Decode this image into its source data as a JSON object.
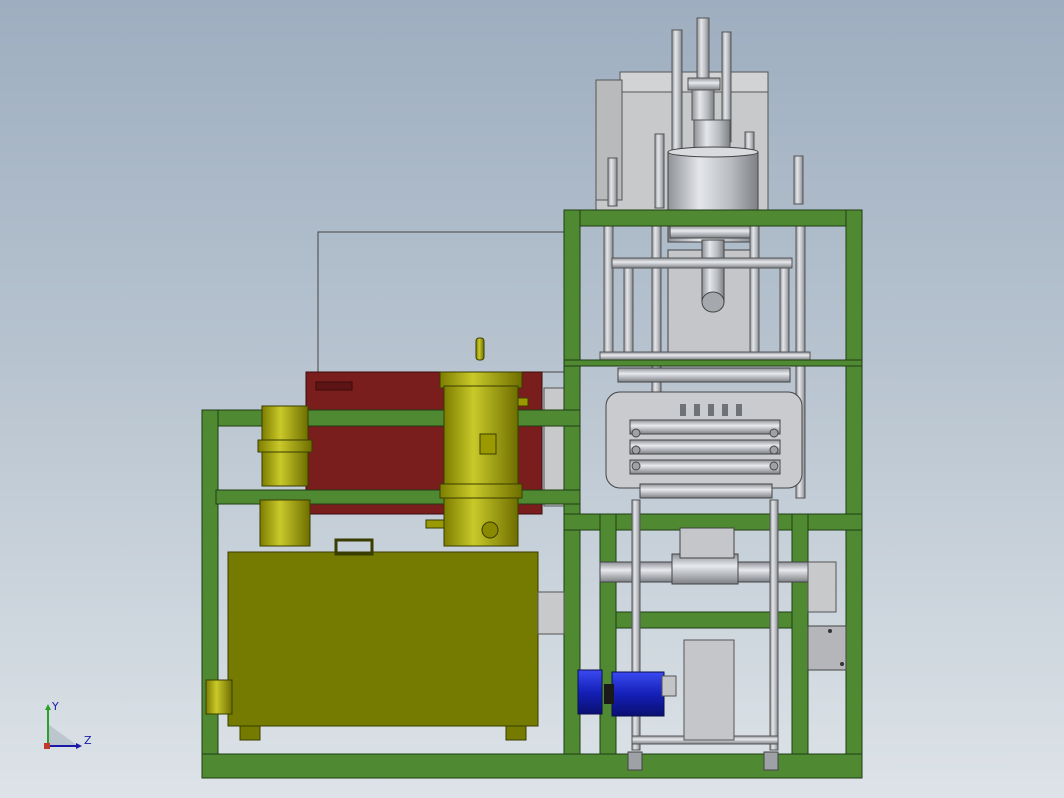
{
  "viewport": {
    "background_top": "#9eaec0",
    "background_bottom": "#dde3e8"
  },
  "colors": {
    "frame": "#4f8a33",
    "frame_edge": "#1f3d12",
    "tank": "#757a00",
    "tank_edge": "#3a3d00",
    "yellow_parts": "#a9a900",
    "heater_box": "#7a1d1d",
    "steel": "#c2c4c8",
    "steel_dark": "#8d9095",
    "motor": "#1e2bd0"
  },
  "triad": {
    "y_label": "Y",
    "z_label": "Z",
    "y_color": "#2aa02a",
    "z_color": "#1a1aa6"
  }
}
